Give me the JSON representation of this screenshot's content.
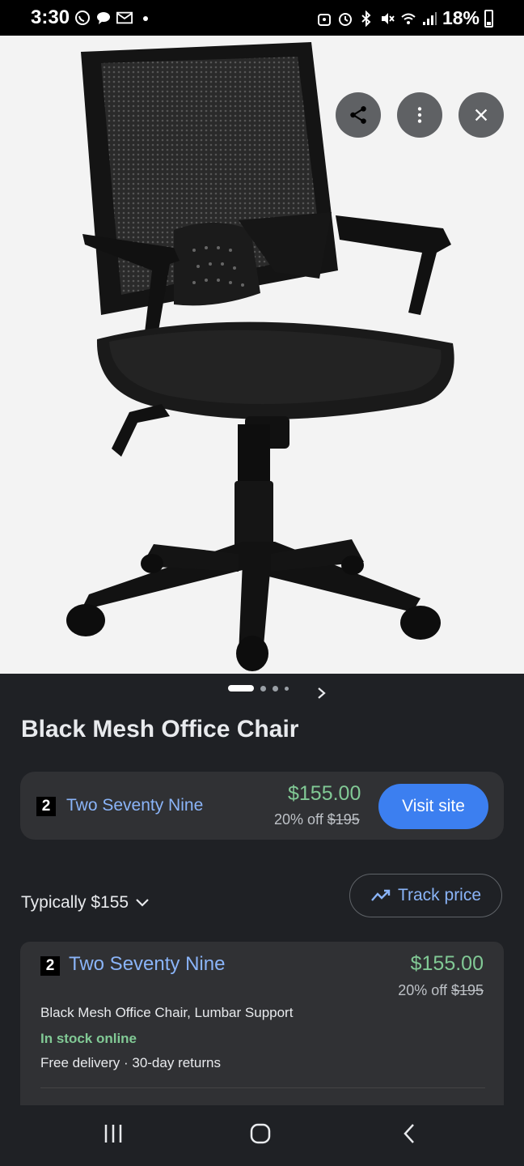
{
  "status": {
    "time": "3:30",
    "battery": "18%"
  },
  "product": {
    "title": "Black Mesh Office Chair",
    "pager_pages": 4
  },
  "offer": {
    "rank": "2",
    "store": "Two Seventy Nine",
    "price": "$155.00",
    "discount_label": "20% off",
    "original_price": "$195",
    "visit_label": "Visit site"
  },
  "price_summary": {
    "typically": "Typically $155",
    "track_label": "Track price"
  },
  "seller": {
    "rank": "2",
    "store": "Two Seventy Nine",
    "price": "$155.00",
    "discount_label": "20% off",
    "original_price": "$195",
    "description": "Black Mesh Office Chair, Lumbar Support",
    "stock": "In stock online",
    "delivery": "Free delivery · 30-day returns"
  },
  "colors": {
    "accent_blue": "#3c7ff0",
    "link_blue": "#8ab4f8",
    "price_green": "#81c995"
  }
}
